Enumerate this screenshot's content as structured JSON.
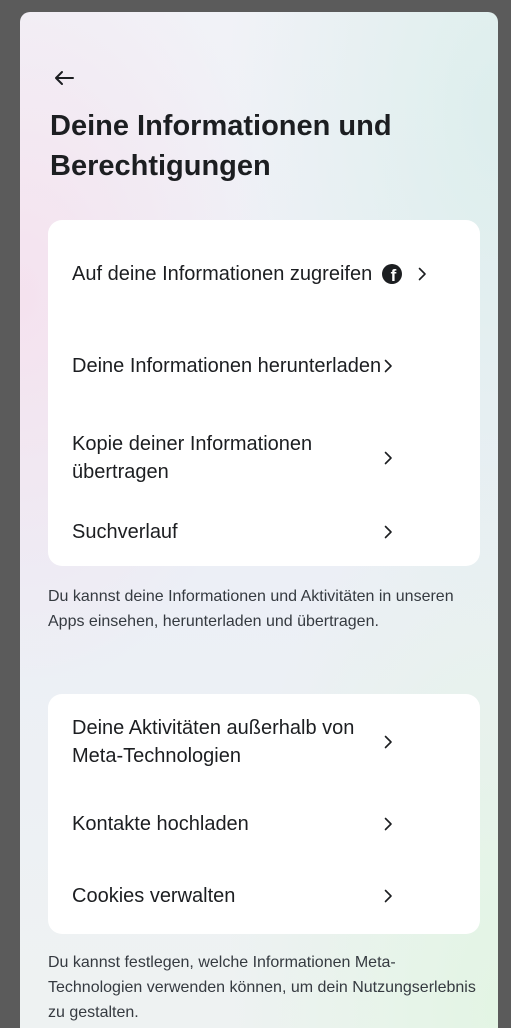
{
  "header": {
    "back_icon": "arrow-left-icon",
    "title": "Deine Informationen und Berechtigungen"
  },
  "section1": {
    "items": [
      {
        "label": "Auf deine Informationen zugreifen",
        "icon": "facebook-icon"
      },
      {
        "label": "Deine Informationen herunterladen"
      },
      {
        "label": "Kopie deiner Informationen übertragen"
      },
      {
        "label": "Suchverlauf"
      }
    ],
    "description": "Du kannst deine Informationen und Aktivitäten in unseren Apps einsehen, herunterladen und übertragen."
  },
  "section2": {
    "items": [
      {
        "label": "Deine Aktivitäten außerhalb von Meta-Technologien"
      },
      {
        "label": "Kontakte hochladen"
      },
      {
        "label": "Cookies verwalten"
      }
    ],
    "description": "Du kannst festlegen, welche Informationen Meta-Technologien verwenden können, um dein Nutzungserlebnis zu gestalten."
  },
  "colors": {
    "text": "#1c1e21",
    "card": "#ffffff",
    "frame": "#5b5b5b"
  }
}
